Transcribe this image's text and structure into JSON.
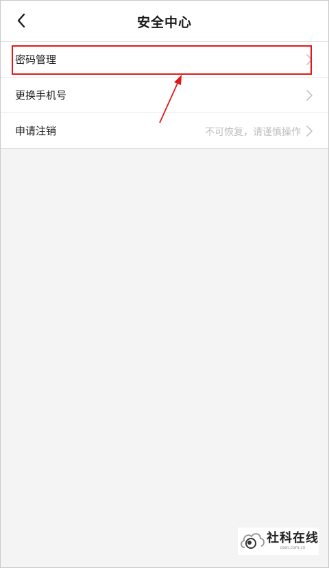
{
  "header": {
    "title": "安全中心",
    "back_icon": "chevron-left-icon"
  },
  "rows": [
    {
      "label": "密码管理",
      "note": "",
      "icon": "chevron-right-icon"
    },
    {
      "label": "更换手机号",
      "note": "",
      "icon": "chevron-right-icon"
    },
    {
      "label": "申请注销",
      "note": "不可恢复，请谨慎操作",
      "icon": "chevron-right-icon"
    }
  ],
  "annotation": {
    "highlight_color": "#e01818",
    "target": "密码管理"
  },
  "watermark": {
    "text": "社科在线",
    "sub": "cssn.com.cn"
  },
  "colors": {
    "background": "#f4f4f4",
    "card": "#ffffff",
    "text": "#1a1a1a",
    "muted": "#bdbdbd"
  }
}
